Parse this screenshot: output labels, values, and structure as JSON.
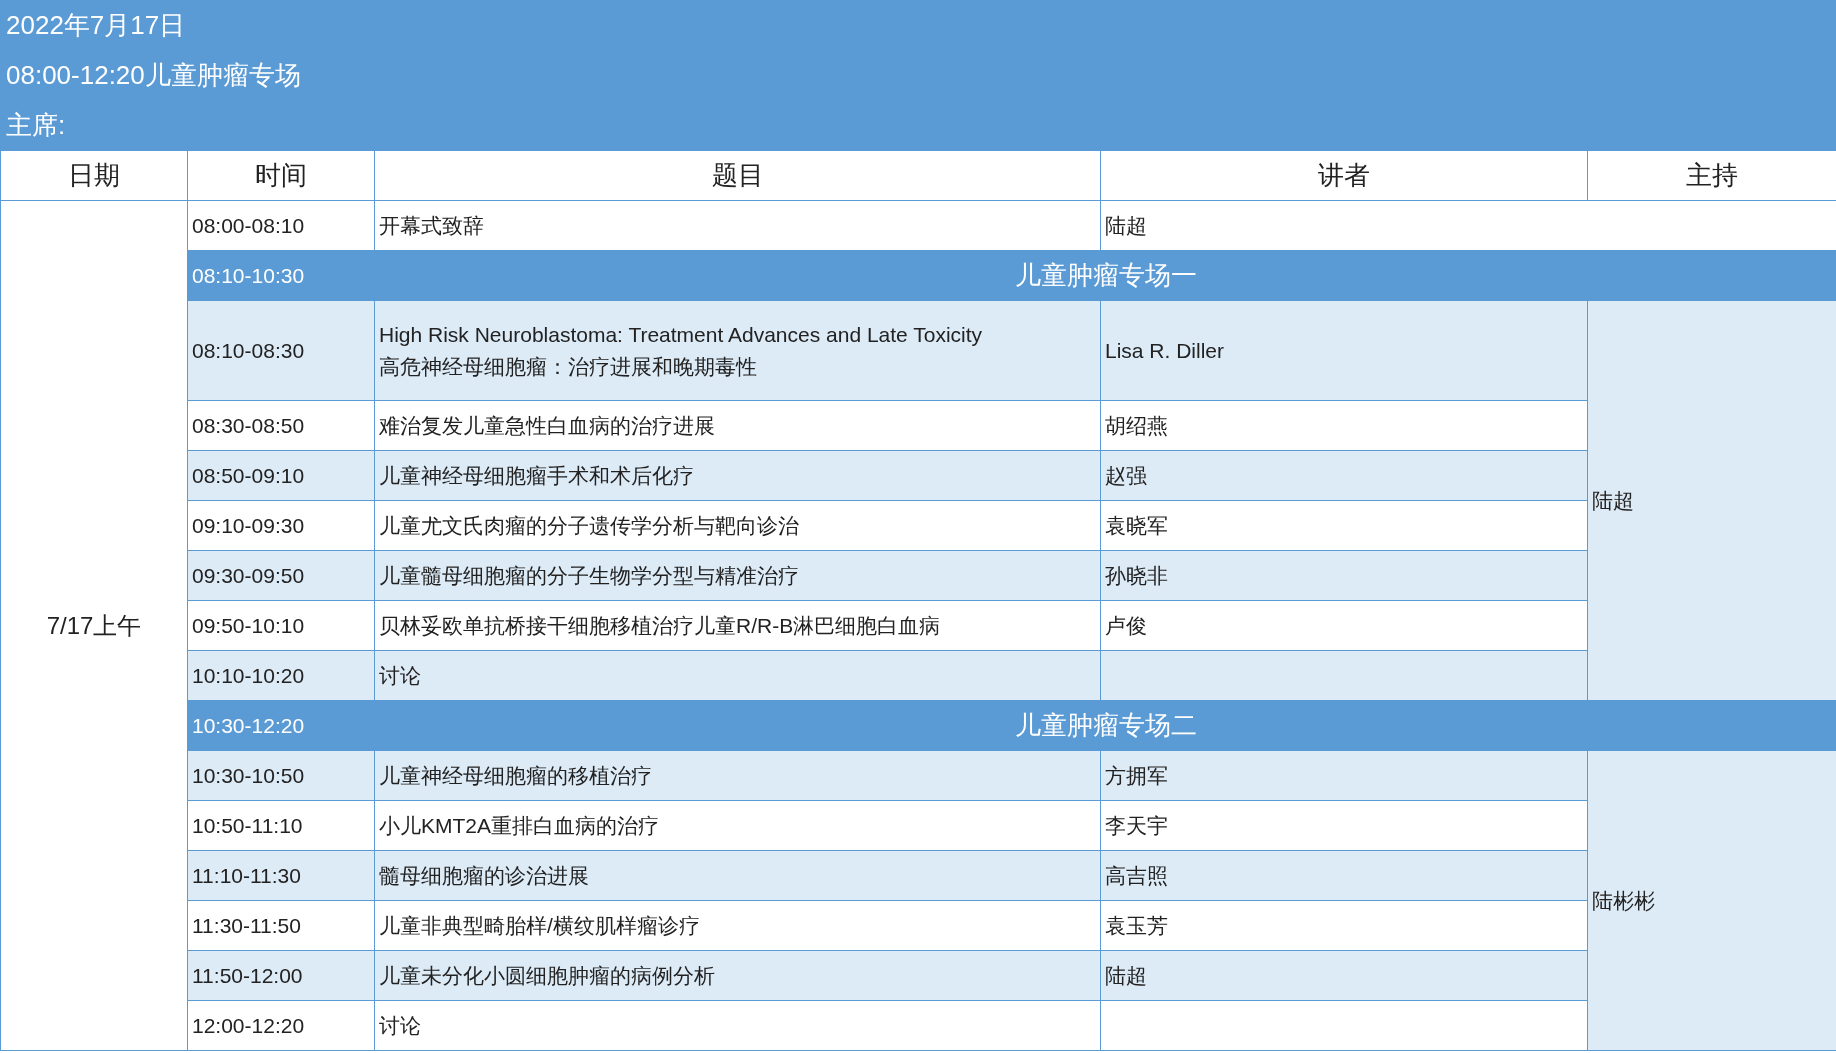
{
  "header": {
    "date": "2022年7月17日",
    "session": "08:00-12:20儿童肿瘤专场",
    "chair": "主席:"
  },
  "columns": [
    "日期",
    "时间",
    "题目",
    "讲者",
    "主持"
  ],
  "date_cell": "7/17上午",
  "opening": {
    "time": "08:00-08:10",
    "title": "开幕式致辞",
    "speaker": "陆超"
  },
  "blocks": [
    {
      "time": "08:10-10:30",
      "title": "儿童肿瘤专场一",
      "host": "陆超",
      "rows": [
        {
          "time": "08:10-08:30",
          "title": "High Risk Neuroblastoma: Treatment Advances and Late Toxicity",
          "subtitle": "高危神经母细胞瘤：治疗进展和晚期毒性",
          "speaker": "Lisa R. Diller"
        },
        {
          "time": "08:30-08:50",
          "title": "难治复发儿童急性白血病的治疗进展",
          "speaker": "胡绍燕"
        },
        {
          "time": "08:50-09:10",
          "title": "儿童神经母细胞瘤手术和术后化疗",
          "speaker": "赵强"
        },
        {
          "time": "09:10-09:30",
          "title": "儿童尤文氏肉瘤的分子遗传学分析与靶向诊治",
          "speaker": "袁晓军"
        },
        {
          "time": "09:30-09:50",
          "title": "儿童髓母细胞瘤的分子生物学分型与精准治疗",
          "speaker": "孙晓非"
        },
        {
          "time": "09:50-10:10",
          "title": "贝林妥欧单抗桥接干细胞移植治疗儿童R/R-B淋巴细胞白血病",
          "speaker": "卢俊"
        },
        {
          "time": "10:10-10:20",
          "title": "讨论"
        }
      ]
    },
    {
      "time": "10:30-12:20",
      "title": "儿童肿瘤专场二",
      "host": "陆彬彬",
      "rows": [
        {
          "time": "10:30-10:50",
          "title": "儿童神经母细胞瘤的移植治疗",
          "speaker": "方拥军"
        },
        {
          "time": "10:50-11:10",
          "title": "小儿KMT2A重排白血病的治疗",
          "speaker": "李天宇"
        },
        {
          "time": "11:10-11:30",
          "title": "髓母细胞瘤的诊治进展",
          "speaker": "高吉照"
        },
        {
          "time": "11:30-11:50",
          "title": "儿童非典型畸胎样/横纹肌样瘤诊疗",
          "speaker": "袁玉芳"
        },
        {
          "time": "11:50-12:00",
          "title": "儿童未分化小圆细胞肿瘤的病例分析",
          "speaker": "陆超"
        },
        {
          "time": "12:00-12:20",
          "title": "讨论"
        }
      ]
    }
  ]
}
